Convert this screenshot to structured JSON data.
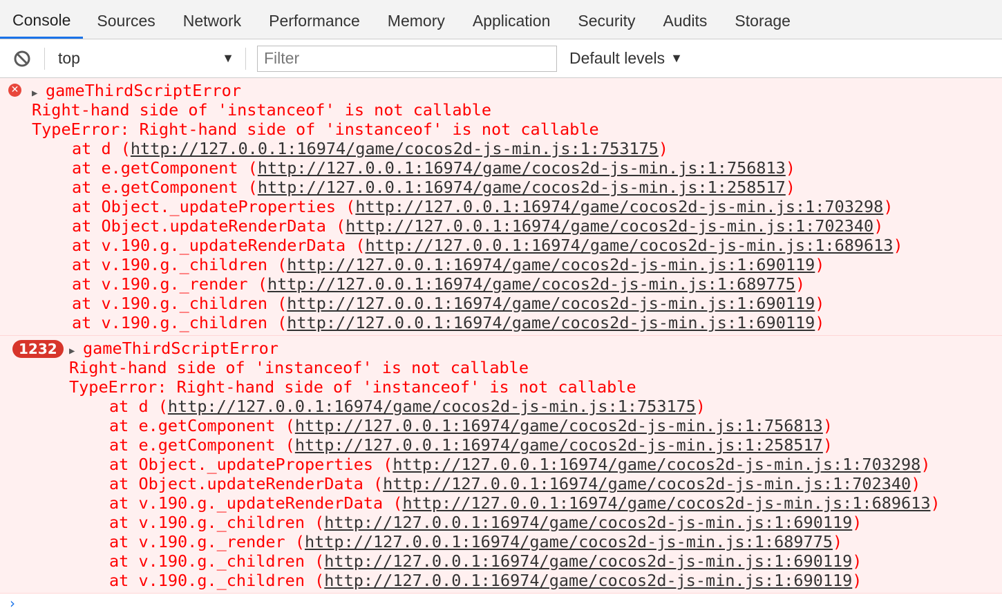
{
  "tabs": [
    "Console",
    "Sources",
    "Network",
    "Performance",
    "Memory",
    "Application",
    "Security",
    "Audits",
    "Storage"
  ],
  "toolbar": {
    "context": "top",
    "filter_placeholder": "Filter",
    "levels": "Default levels"
  },
  "messages": [
    {
      "repeat": "",
      "title": "gameThirdScriptError",
      "msg1": "Right-hand side of 'instanceof' is not callable",
      "msg2": "TypeError: Right-hand side of 'instanceof' is not callable",
      "frames": [
        {
          "fn": "at d ",
          "url": "http://127.0.0.1:16974/game/cocos2d-js-min.js:1:753175"
        },
        {
          "fn": "at e.getComponent ",
          "url": "http://127.0.0.1:16974/game/cocos2d-js-min.js:1:756813"
        },
        {
          "fn": "at e.getComponent ",
          "url": "http://127.0.0.1:16974/game/cocos2d-js-min.js:1:258517"
        },
        {
          "fn": "at Object._updateProperties ",
          "url": "http://127.0.0.1:16974/game/cocos2d-js-min.js:1:703298"
        },
        {
          "fn": "at Object.updateRenderData ",
          "url": "http://127.0.0.1:16974/game/cocos2d-js-min.js:1:702340"
        },
        {
          "fn": "at v.190.g._updateRenderData ",
          "url": "http://127.0.0.1:16974/game/cocos2d-js-min.js:1:689613"
        },
        {
          "fn": "at v.190.g._children ",
          "url": "http://127.0.0.1:16974/game/cocos2d-js-min.js:1:690119"
        },
        {
          "fn": "at v.190.g._render ",
          "url": "http://127.0.0.1:16974/game/cocos2d-js-min.js:1:689775"
        },
        {
          "fn": "at v.190.g._children ",
          "url": "http://127.0.0.1:16974/game/cocos2d-js-min.js:1:690119"
        },
        {
          "fn": "at v.190.g._children ",
          "url": "http://127.0.0.1:16974/game/cocos2d-js-min.js:1:690119"
        }
      ]
    },
    {
      "repeat": "1232",
      "title": "gameThirdScriptError",
      "msg1": "Right-hand side of 'instanceof' is not callable",
      "msg2": "TypeError: Right-hand side of 'instanceof' is not callable",
      "frames": [
        {
          "fn": "at d ",
          "url": "http://127.0.0.1:16974/game/cocos2d-js-min.js:1:753175"
        },
        {
          "fn": "at e.getComponent ",
          "url": "http://127.0.0.1:16974/game/cocos2d-js-min.js:1:756813"
        },
        {
          "fn": "at e.getComponent ",
          "url": "http://127.0.0.1:16974/game/cocos2d-js-min.js:1:258517"
        },
        {
          "fn": "at Object._updateProperties ",
          "url": "http://127.0.0.1:16974/game/cocos2d-js-min.js:1:703298"
        },
        {
          "fn": "at Object.updateRenderData ",
          "url": "http://127.0.0.1:16974/game/cocos2d-js-min.js:1:702340"
        },
        {
          "fn": "at v.190.g._updateRenderData ",
          "url": "http://127.0.0.1:16974/game/cocos2d-js-min.js:1:689613"
        },
        {
          "fn": "at v.190.g._children ",
          "url": "http://127.0.0.1:16974/game/cocos2d-js-min.js:1:690119"
        },
        {
          "fn": "at v.190.g._render ",
          "url": "http://127.0.0.1:16974/game/cocos2d-js-min.js:1:689775"
        },
        {
          "fn": "at v.190.g._children ",
          "url": "http://127.0.0.1:16974/game/cocos2d-js-min.js:1:690119"
        },
        {
          "fn": "at v.190.g._children ",
          "url": "http://127.0.0.1:16974/game/cocos2d-js-min.js:1:690119"
        }
      ]
    }
  ],
  "icons": {
    "clear": "clear-console-icon",
    "error": "error-icon",
    "expand": "expand-triangle-icon",
    "prompt": "prompt-chevron-icon"
  }
}
